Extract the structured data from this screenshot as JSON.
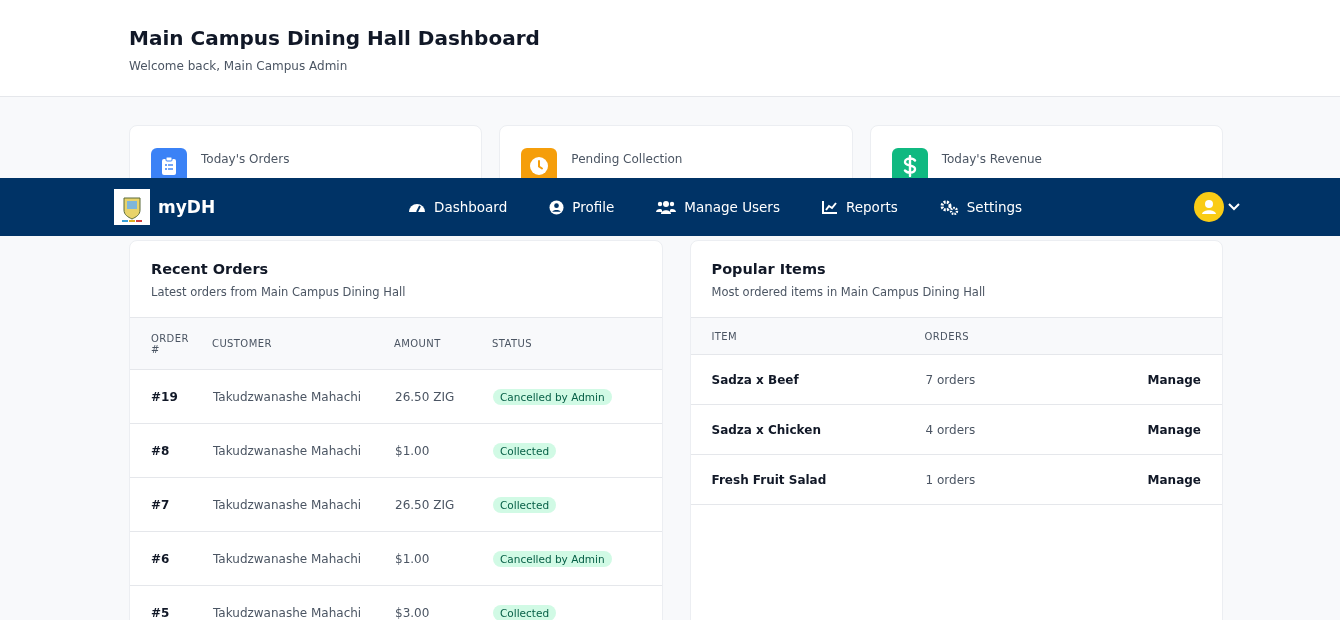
{
  "header": {
    "title": "Main Campus Dining Hall Dashboard",
    "subtitle": "Welcome back, Main Campus Admin"
  },
  "stats": [
    {
      "kind": "orders",
      "label": "Today's Orders",
      "color": "#3b82f6"
    },
    {
      "kind": "pending",
      "label": "Pending Collection",
      "color": "#f59e0b"
    },
    {
      "kind": "revenue",
      "label": "Today's Revenue",
      "color": "#10b981"
    }
  ],
  "navbar": {
    "brand": "myDH",
    "items": [
      {
        "kind": "dashboard",
        "label": "Dashboard"
      },
      {
        "kind": "profile",
        "label": "Profile"
      },
      {
        "kind": "users",
        "label": "Manage Users"
      },
      {
        "kind": "reports",
        "label": "Reports"
      },
      {
        "kind": "settings",
        "label": "Settings"
      }
    ]
  },
  "recent_orders": {
    "title": "Recent Orders",
    "subtitle": "Latest orders from Main Campus Dining Hall",
    "columns": [
      "ORDER #",
      "CUSTOMER",
      "AMOUNT",
      "STATUS"
    ],
    "rows": [
      {
        "order": "#19",
        "customer": "Takudzwanashe Mahachi",
        "amount": "26.50 ZIG",
        "status": "Cancelled by Admin"
      },
      {
        "order": "#8",
        "customer": "Takudzwanashe Mahachi",
        "amount": "$1.00",
        "status": "Collected"
      },
      {
        "order": "#7",
        "customer": "Takudzwanashe Mahachi",
        "amount": "26.50 ZIG",
        "status": "Collected"
      },
      {
        "order": "#6",
        "customer": "Takudzwanashe Mahachi",
        "amount": "$1.00",
        "status": "Cancelled by Admin"
      },
      {
        "order": "#5",
        "customer": "Takudzwanashe Mahachi",
        "amount": "$3.00",
        "status": "Collected"
      }
    ]
  },
  "popular_items": {
    "title": "Popular Items",
    "subtitle": "Most ordered items in Main Campus Dining Hall",
    "columns": [
      "ITEM",
      "ORDERS"
    ],
    "rows": [
      {
        "item": "Sadza x Beef",
        "orders": "7 orders",
        "action": "Manage"
      },
      {
        "item": "Sadza x Chicken",
        "orders": "4 orders",
        "action": "Manage"
      },
      {
        "item": "Fresh Fruit Salad",
        "orders": "1 orders",
        "action": "Manage"
      }
    ]
  }
}
